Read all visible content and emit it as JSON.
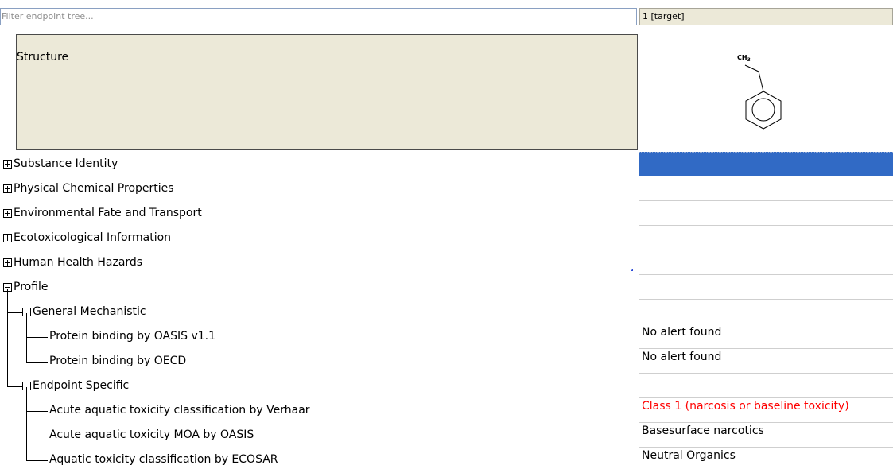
{
  "filter": {
    "placeholder": "Filter endpoint tree..."
  },
  "column_header": "1 [target]",
  "structure": {
    "label": "Structure",
    "molecule": {
      "group_label": "CH3",
      "group_label_main": "CH",
      "group_label_sub": "3"
    }
  },
  "tree": {
    "substance_identity": "Substance Identity",
    "physical_chemical": "Physical Chemical Properties",
    "environmental_fate": "Environmental Fate and Transport",
    "ecotoxicological": "Ecotoxicological Information",
    "human_health": "Human Health Hazards",
    "profile": "Profile",
    "general_mechanistic": "General Mechanistic",
    "protein_oasis": "Protein binding by OASIS v1.1",
    "protein_oecd": "Protein binding by OECD",
    "endpoint_specific": "Endpoint Specific",
    "verhaar": "Acute aquatic toxicity classification by Verhaar",
    "moa_oasis": "Acute aquatic toxicity MOA by OASIS",
    "ecosar": "Aquatic toxicity classification by ECOSAR"
  },
  "values": {
    "protein_oasis": "No alert found",
    "protein_oecd": "No alert found",
    "verhaar": "Class 1 (narcosis or baseline toxicity)",
    "moa_oasis": "Basesurface narcotics",
    "ecosar": "Neutral Organics"
  },
  "colors": {
    "selection": "#316ac5",
    "alert_red": "#ff0000",
    "header_bg": "#ece9d8"
  }
}
